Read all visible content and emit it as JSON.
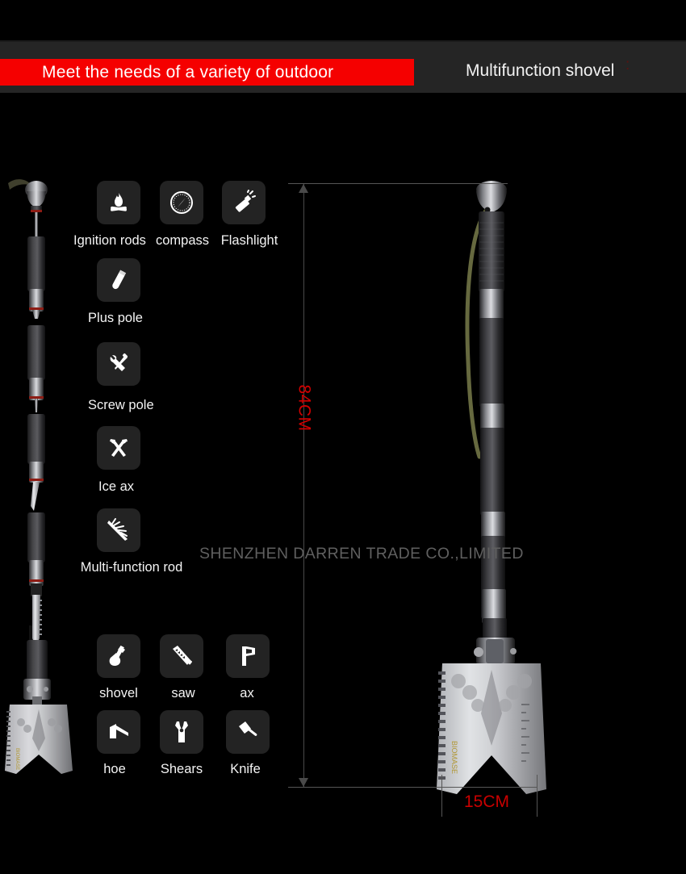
{
  "header": {
    "banner_text": "Meet the needs of a variety of outdoor",
    "banner_color": "#f50000",
    "title": "Multifunction shovel",
    "mark": ":",
    "band_color": "#252525"
  },
  "watermark": "SHENZHEN  DARREN TRADE CO.,LIMITED",
  "dimensions": {
    "height_label": "84CM",
    "width_label": "15CM",
    "label_color": "#cc0000"
  },
  "features": {
    "row_top": [
      {
        "label": "Ignition rods",
        "icon": "campfire-icon"
      },
      {
        "label": "compass",
        "icon": "compass-icon"
      },
      {
        "label": "Flashlight",
        "icon": "flashlight-icon"
      }
    ],
    "column": [
      {
        "label": "Plus pole",
        "icon": "rod-icon"
      },
      {
        "label": "Screw pole",
        "icon": "wrench-screwdriver-icon"
      },
      {
        "label": "Ice ax",
        "icon": "crossed-ice-axes-icon"
      },
      {
        "label": "Multi-function rod",
        "icon": "multitool-icon"
      }
    ],
    "row_bottom_1": [
      {
        "label": "shovel",
        "icon": "shovel-icon"
      },
      {
        "label": "saw",
        "icon": "saw-icon"
      },
      {
        "label": "ax",
        "icon": "axe-icon"
      }
    ],
    "row_bottom_2": [
      {
        "label": "hoe",
        "icon": "hoe-icon"
      },
      {
        "label": "Shears",
        "icon": "pliers-icon"
      },
      {
        "label": "Knife",
        "icon": "cleaver-icon"
      }
    ]
  },
  "product": {
    "exploded_view_alt": "disassembled shovel rod segments",
    "assembled_view_alt": "assembled multifunction shovel"
  }
}
